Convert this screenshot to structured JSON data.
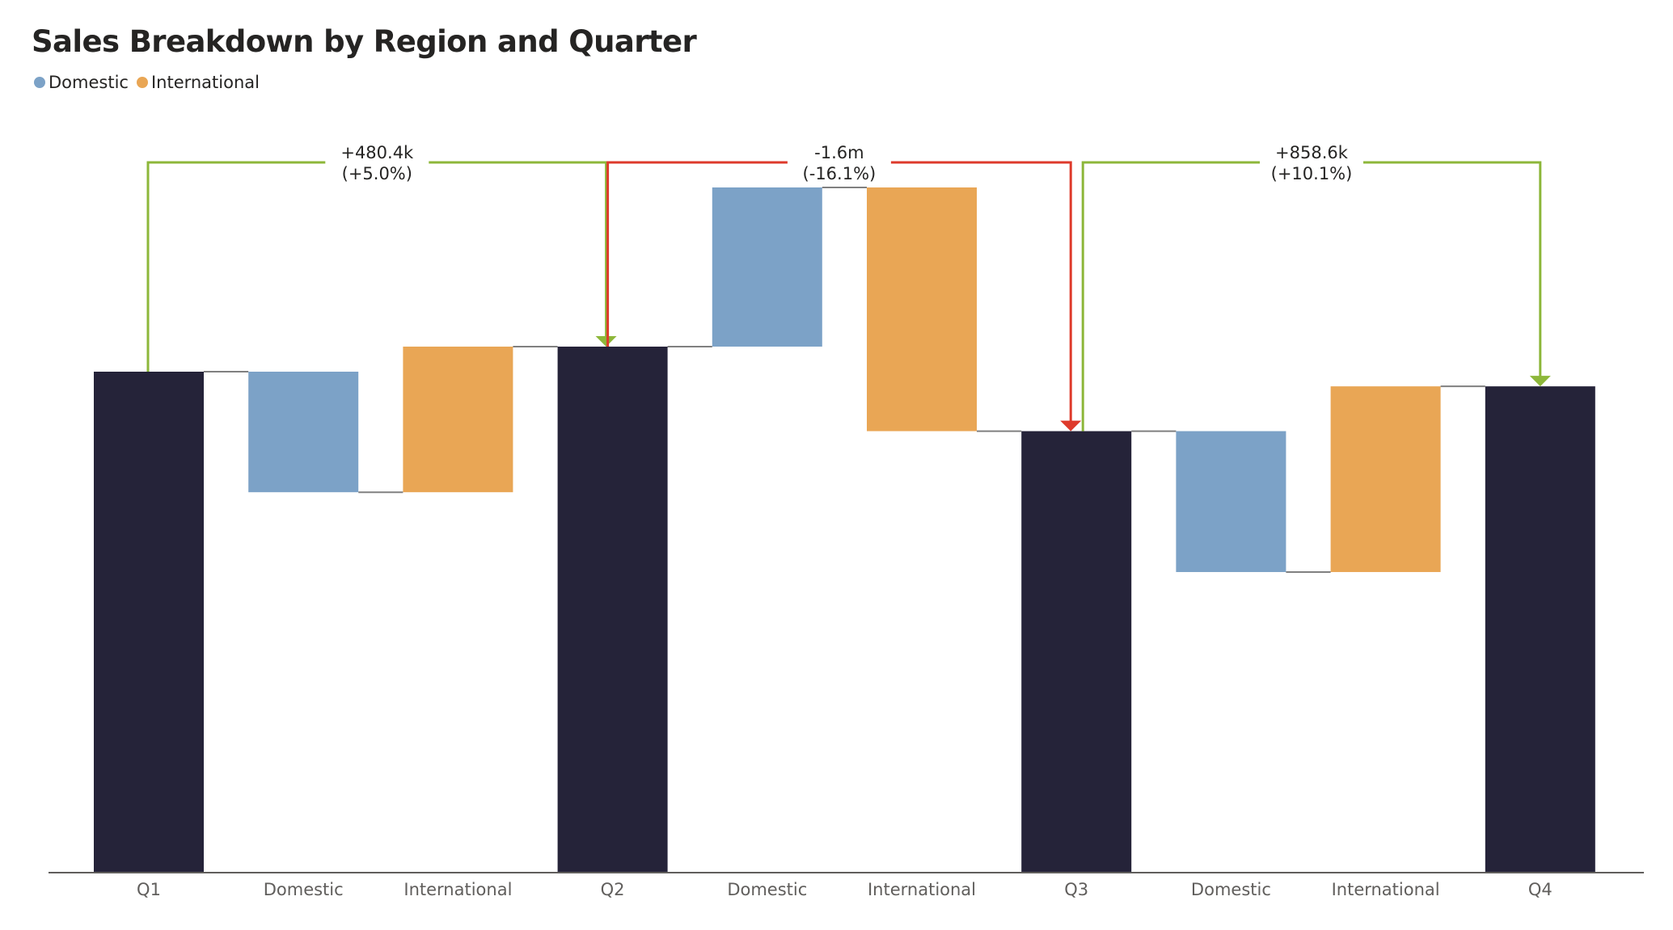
{
  "chart_data": {
    "type": "waterfall",
    "title": "Sales Breakdown by Region and Quarter",
    "legend": {
      "placement": "top-left",
      "entries": [
        {
          "name": "Domestic",
          "color": "#7CA2C7"
        },
        {
          "name": "International",
          "color": "#E9A655"
        }
      ]
    },
    "colors": {
      "total": "#252339",
      "Domestic": "#7CA2C7",
      "International": "#E9A655",
      "increase": "#8DB73A",
      "decrease": "#DE3A2B",
      "connector": "#808080",
      "axis": "#605E5C"
    },
    "categories": [
      "Q1",
      "Domestic",
      "International",
      "Q2",
      "Domestic",
      "International",
      "Q3",
      "Domestic",
      "International",
      "Q4"
    ],
    "bars": [
      {
        "label": "Q1",
        "kind": "total",
        "value": 9600000
      },
      {
        "label": "Domestic",
        "kind": "Domestic",
        "value": -2310000
      },
      {
        "label": "International",
        "kind": "International",
        "value": 2790400
      },
      {
        "label": "Q2",
        "kind": "total",
        "value": 10080400
      },
      {
        "label": "Domestic",
        "kind": "Domestic",
        "value": 3050000
      },
      {
        "label": "International",
        "kind": "International",
        "value": -4670000
      },
      {
        "label": "Q3",
        "kind": "total",
        "value": 8460400
      },
      {
        "label": "Domestic",
        "kind": "Domestic",
        "value": -2700000
      },
      {
        "label": "International",
        "kind": "International",
        "value": 3558600
      },
      {
        "label": "Q4",
        "kind": "total",
        "value": 9319000
      }
    ],
    "annotations": [
      {
        "from": "Q1",
        "to": "Q2",
        "delta_label": "+480.4k",
        "pct_label": "(+5.0%)",
        "direction": "increase"
      },
      {
        "from": "Q2",
        "to": "Q3",
        "delta_label": "-1.6m",
        "pct_label": "(-16.1%)",
        "direction": "decrease"
      },
      {
        "from": "Q3",
        "to": "Q4",
        "delta_label": "+858.6k",
        "pct_label": "(+10.1%)",
        "direction": "increase"
      }
    ],
    "xlabel": "",
    "ylabel": "",
    "ylim": [
      0,
      16000000
    ],
    "grid": false,
    "y_axis_visible": false
  }
}
